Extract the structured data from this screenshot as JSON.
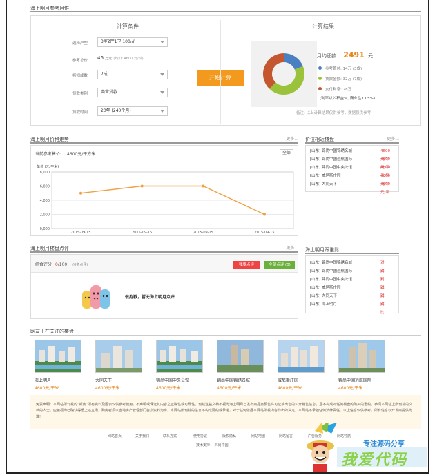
{
  "calc": {
    "section_title": "海上明月参考月供",
    "cond_title": "计算条件",
    "result_title": "计算结果",
    "fields": [
      {
        "label": "选择户型",
        "value": "3室2厅1卫 100㎡"
      },
      {
        "label": "参考总价",
        "value_num": "46",
        "value_unit": "万元",
        "value_note": "(均价: 4600 元/㎡)"
      },
      {
        "label": "按揭成数",
        "value": "7成"
      },
      {
        "label": "贷款类别",
        "value": "商业贷款"
      },
      {
        "label": "贷款时间",
        "value": "20年 (240个月)"
      }
    ],
    "button": "开始计算",
    "monthly_label": "月均还款",
    "monthly_value": "2491",
    "monthly_unit": "元",
    "legend": [
      {
        "text": "参考首付: 14万 (3成)",
        "color": "#4a7fc1"
      },
      {
        "text": "贷款金额: 32万 (7成)",
        "color": "#9ac23a"
      },
      {
        "text": "支付利息: 28万",
        "color": "#c4572f"
      }
    ],
    "rate_note": "(利率以公积金%, 商业性7.05%)",
    "footnote": "备注: 以上计算结果仅供参考，数据仅供参考",
    "donut": [
      {
        "name": "参考首付",
        "value": 14,
        "color": "#4a7fc1"
      },
      {
        "name": "贷款金额",
        "value": 32,
        "color": "#9ac23a"
      },
      {
        "name": "支付利息",
        "value": 28,
        "color": "#c4572f"
      }
    ]
  },
  "price_trend": {
    "section_title": "海上明月价格走势",
    "more": "更多...",
    "current_label": "当前参考售价:",
    "current_value": "4600元/平方米",
    "all_button": "全部",
    "unit_label": "单位 (元/平米)",
    "chart_data": {
      "type": "line",
      "x": [
        "2015-09-15",
        "2015-09-15",
        "2015-09-15",
        "2015-09-15"
      ],
      "y": [
        5000,
        6000,
        6000,
        2000
      ],
      "ylim": [
        0,
        8000
      ],
      "yticks": [
        "8,000",
        "6,000",
        "4,000",
        "2,000",
        "0,000"
      ],
      "color": "#f0a040",
      "grid": true
    }
  },
  "nearby": {
    "title": "价位相近楼盘",
    "more": "更多...",
    "items": [
      {
        "name": "[山东] 锦尚中国锦绣名城",
        "price": "4600元/平"
      },
      {
        "name": "[山东] 锦尚中国远航国际",
        "price": "4600元/平"
      },
      {
        "name": "[山东] 锦尚中国中央公馆",
        "price": "4600元/平"
      },
      {
        "name": "[山东] 威尼斯庄园",
        "price": "4600元/平"
      },
      {
        "name": "[山东] 大同天下",
        "price": "4600元/平"
      }
    ]
  },
  "reviews": {
    "section_title": "海上明月楼盘点评",
    "more": "更多...",
    "score_label": "综合评分",
    "score_value": "0",
    "score_total": "/100",
    "score_count": "(0条点评)",
    "btn_review": "我要点评",
    "btn_all": "全部点评 (0)",
    "empty_text": "很抱歉，暂无海上明月点评"
  },
  "compare": {
    "title": "海上明月跟谁比",
    "action": "对比",
    "items": [
      "[山东] 锦尚中国锦绣名城",
      "[山东] 锦尚中国远航国际",
      "[山东] 锦尚中国中央公馆",
      "[山东] 威尼斯庄园",
      "[山东] 大同天下",
      "[山东] 海上明月"
    ]
  },
  "watching": {
    "title": "网友正在关注的楼盘",
    "items": [
      {
        "name": "海上明月",
        "price": "4600元/平米"
      },
      {
        "name": "大同天下",
        "price": "4600元/平米"
      },
      {
        "name": "锦尚中国中央公馆",
        "price": "4600元/平米"
      },
      {
        "name": "锦尚中国锦绣名城",
        "price": "4600元/平米"
      },
      {
        "name": "威尼斯庄园",
        "price": "4600元/平米"
      },
      {
        "name": "锦尚中国远航国际",
        "price": "4600元/平米"
      }
    ]
  },
  "disclaimer": "免责声明：本网站所刊载的“新房”所有资料及图表仅供参考使用，不声明或保证其内容之正确性或可靠性，刊载这些文档不视为海上明月已发布商品房预售许可证或出售的公开销售信息，且不构成对任何楼盘的购买的邀约。参阅本网站上所刊载的文档的人士，应被视为已确认得悉上述立场，购房者须以当地房产管理部门备案资料为准，本网站所刊载的信息不构成要约或承诺，对于任何依据本网站所载内容作出的决定，本网站不承担任何法律责任。以上信息仅供参考，所有信息以开发商提供为准!",
  "footer": {
    "links": [
      "网站首页",
      "关于我们",
      "联系方式",
      "使用协议",
      "版权隐私",
      "网站地图",
      "网站留言",
      "广告服务",
      "网站导航"
    ],
    "support": "技术支持： 林尚中国"
  },
  "watermark": {
    "line1": "专注源码分享",
    "line2": "我爱代码"
  }
}
